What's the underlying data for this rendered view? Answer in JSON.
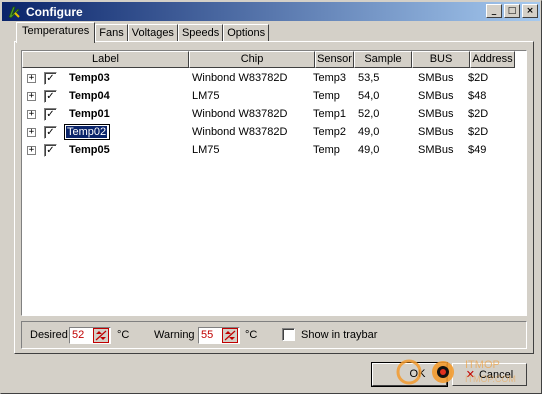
{
  "window": {
    "title": "Configure",
    "controls": [
      "_",
      "□",
      "×"
    ]
  },
  "tabs": [
    {
      "label": "Temperatures",
      "active": true
    },
    {
      "label": "Fans",
      "active": false
    },
    {
      "label": "Voltages",
      "active": false
    },
    {
      "label": "Speeds",
      "active": false
    },
    {
      "label": "Options",
      "active": false
    }
  ],
  "table": {
    "columns": [
      "Label",
      "Chip",
      "Sensor",
      "Sample",
      "BUS",
      "Address"
    ],
    "rows": [
      {
        "label": "Temp03",
        "chip": "Winbond W83782D",
        "sensor": "Temp3",
        "sample": "53,5",
        "bus": "SMBus",
        "address": "$2D",
        "checked": true,
        "editing": false
      },
      {
        "label": "Temp04",
        "chip": "LM75",
        "sensor": "Temp",
        "sample": "54,0",
        "bus": "SMBus",
        "address": "$48",
        "checked": true,
        "editing": false
      },
      {
        "label": "Temp01",
        "chip": "Winbond W83782D",
        "sensor": "Temp1",
        "sample": "52,0",
        "bus": "SMBus",
        "address": "$2D",
        "checked": true,
        "editing": false
      },
      {
        "label": "Temp02",
        "chip": "Winbond W83782D",
        "sensor": "Temp2",
        "sample": "49,0",
        "bus": "SMBus",
        "address": "$2D",
        "checked": true,
        "editing": true
      },
      {
        "label": "Temp05",
        "chip": "LM75",
        "sensor": "Temp",
        "sample": "49,0",
        "bus": "SMBus",
        "address": "$49",
        "checked": true,
        "editing": false
      }
    ]
  },
  "bottom": {
    "desired_label": "Desired",
    "desired_value": "52",
    "desired_unit": "°C",
    "warning_label": "Warning",
    "warning_value": "55",
    "warning_unit": "°C",
    "traybar_label": "Show in traybar",
    "traybar_checked": false
  },
  "buttons": {
    "ok": "OK",
    "cancel": "Cancel"
  },
  "colors": {
    "title_start": "#0a246a",
    "title_end": "#a6caf0",
    "face": "#d4d0c8",
    "accent_red": "#c00000",
    "selection": "#0a246a"
  },
  "watermark": {
    "text": "ITMOP.COM"
  }
}
